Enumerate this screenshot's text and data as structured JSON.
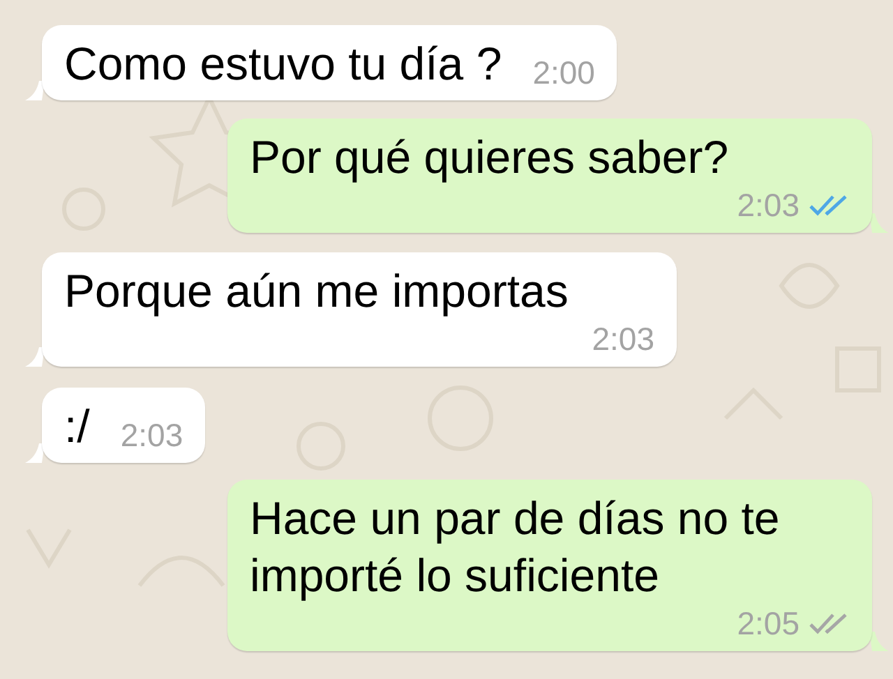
{
  "messages": [
    {
      "kind": "incoming",
      "text": "Como estuvo tu día ?",
      "time": "2:00"
    },
    {
      "kind": "outgoing",
      "text": "Por qué quieres saber?",
      "time": "2:03",
      "read": true
    },
    {
      "kind": "incoming",
      "text": "Porque aún me importas",
      "time": "2:03"
    },
    {
      "kind": "incoming",
      "text": ":/",
      "time": "2:03"
    },
    {
      "kind": "outgoing",
      "text": "Hace un par de días no te importé lo suficiente",
      "time": "2:05",
      "read": false
    }
  ]
}
